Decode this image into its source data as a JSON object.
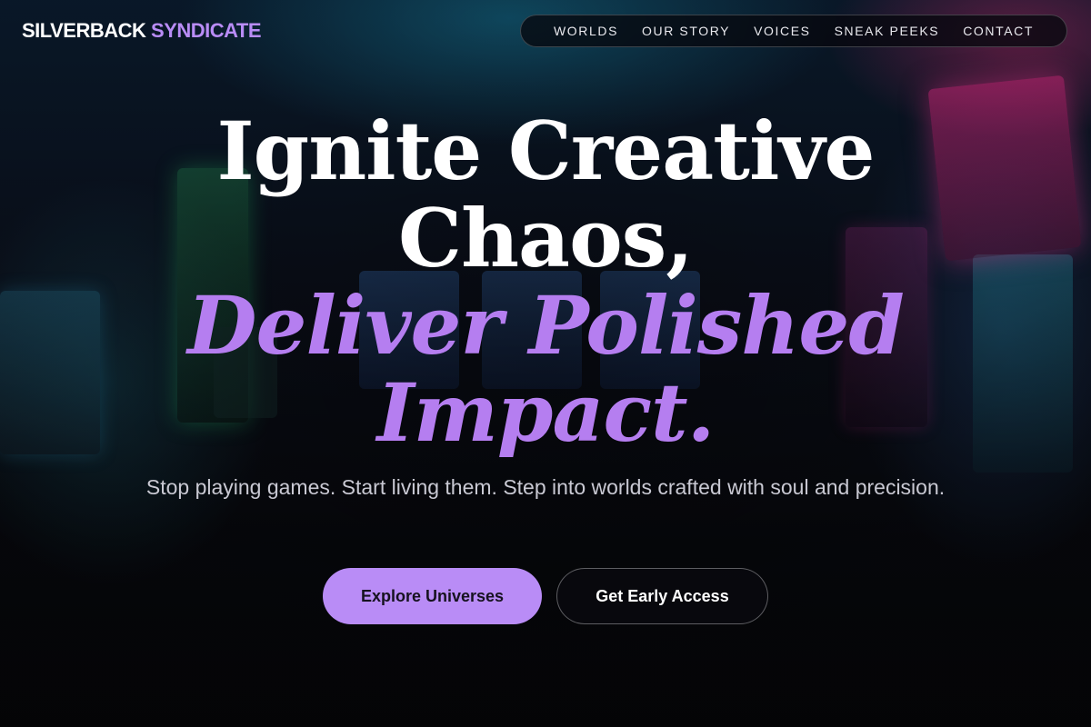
{
  "brand": {
    "name_primary": "SILVERBACK",
    "name_accent": "SYNDICATE",
    "accent_color": "#b98cf6"
  },
  "nav": {
    "items": [
      {
        "label": "WORLDS"
      },
      {
        "label": "OUR STORY"
      },
      {
        "label": "VOICES"
      },
      {
        "label": "SNEAK PEEKS"
      },
      {
        "label": "CONTACT"
      }
    ]
  },
  "hero": {
    "headline_line1": "Ignite Creative",
    "headline_line2": "Chaos,",
    "headline_accent_line1": "Deliver Polished",
    "headline_accent_line2": "Impact.",
    "subtitle": "Stop playing games. Start living them. Step into worlds crafted with soul and precision.",
    "primary_cta": "Explore Universes",
    "secondary_cta": "Get Early Access"
  }
}
